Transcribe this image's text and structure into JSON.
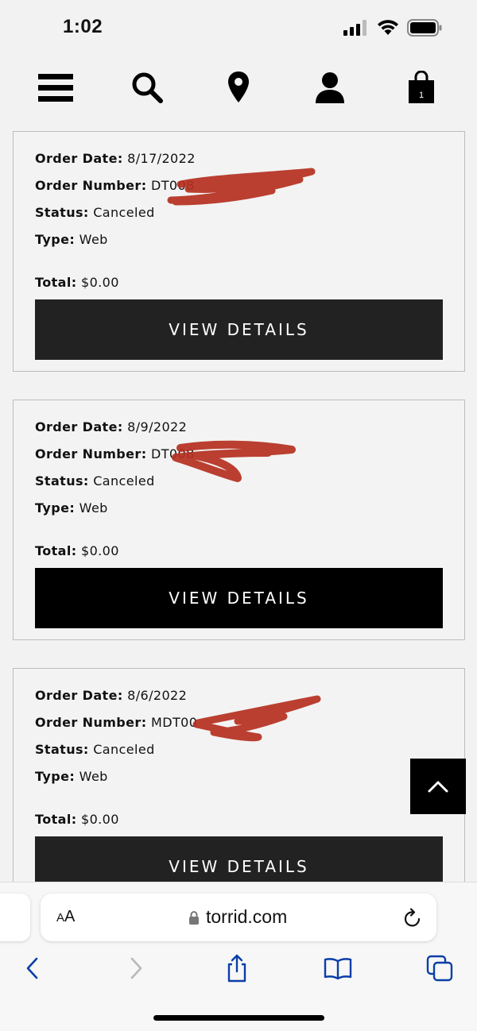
{
  "status_bar": {
    "time": "1:02"
  },
  "header": {
    "icons": [
      "menu-icon",
      "search-icon",
      "location-pin-icon",
      "account-icon",
      "shopping-bag-icon"
    ],
    "bag_count": "1"
  },
  "labels": {
    "order_date": "Order Date:",
    "order_number": "Order Number:",
    "status": "Status:",
    "type": "Type:",
    "total": "Total:"
  },
  "orders": [
    {
      "date": "8/17/2022",
      "number": "DT008",
      "status": "Canceled",
      "type": "Web",
      "total": "$0.00",
      "button": "VIEW DETAILS"
    },
    {
      "date": "8/9/2022",
      "number": "DT008",
      "status": "Canceled",
      "type": "Web",
      "total": "$0.00",
      "button": "VIEW DETAILS"
    },
    {
      "date": "8/6/2022",
      "number": "MDT00",
      "status": "Canceled",
      "type": "Web",
      "total": "$0.00",
      "button": "VIEW DETAILS"
    }
  ],
  "browser": {
    "text_size_label_small": "A",
    "text_size_label_large": "A",
    "url": "torrid.com"
  },
  "colors": {
    "accent": "#000000",
    "redaction": "#b5301f",
    "ios_blue": "#0a3ea8"
  }
}
